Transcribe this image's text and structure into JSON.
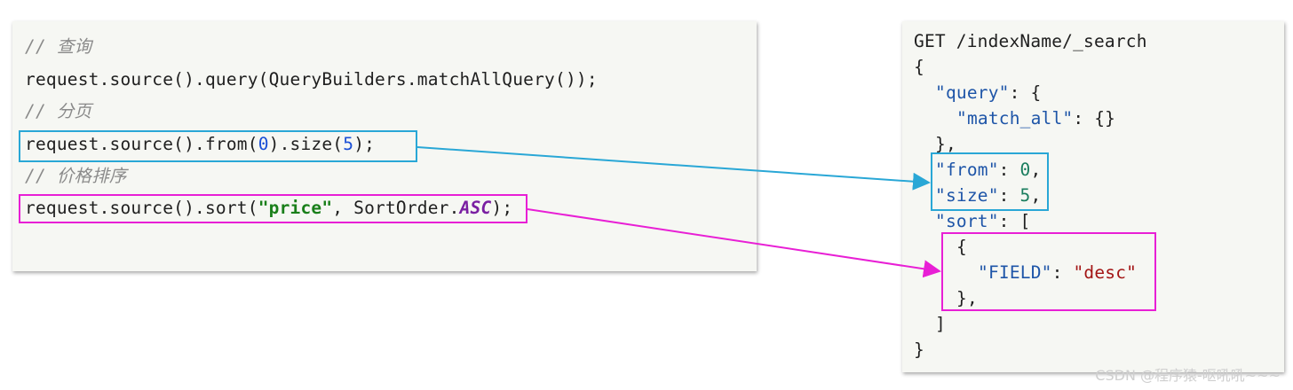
{
  "java_panel": {
    "comment_query": "// 查询",
    "line_query": "request.source().query(QueryBuilders.matchAllQuery());",
    "comment_page": "// 分页",
    "line_page_a": "request.source().from(",
    "line_page_num1": "0",
    "line_page_b": ").size(",
    "line_page_num2": "5",
    "line_page_c": ");",
    "comment_sort": "// 价格排序",
    "line_sort_a": "request.source().sort(",
    "line_sort_str": "\"price\"",
    "line_sort_b": ", SortOrder.",
    "line_sort_enum": "ASC",
    "line_sort_c": ");"
  },
  "dsl_panel": {
    "request_line": "GET /indexName/_search",
    "open_brace": "{",
    "query_key": "\"query\"",
    "query_rest": ": {",
    "match_all_key": "\"match_all\"",
    "match_all_rest": ": {}",
    "query_close": "},",
    "from_key": "\"from\"",
    "from_sep": ": ",
    "from_val": "0",
    "from_comma": ",",
    "size_key": "\"size\"",
    "size_sep": ": ",
    "size_val": "5",
    "size_comma": ",",
    "sort_key": "\"sort\"",
    "sort_rest": ": [",
    "sort_obj_open": "{",
    "field_key": "\"FIELD\"",
    "field_sep": ": ",
    "field_val": "\"desc\"",
    "sort_obj_close": "},",
    "sort_close": "]",
    "close_brace": "}"
  },
  "colors": {
    "paging_highlight": "#29a7d6",
    "sort_highlight": "#e81fd5"
  },
  "watermark": "CSDN @程序猿-呕吼吼~~~"
}
